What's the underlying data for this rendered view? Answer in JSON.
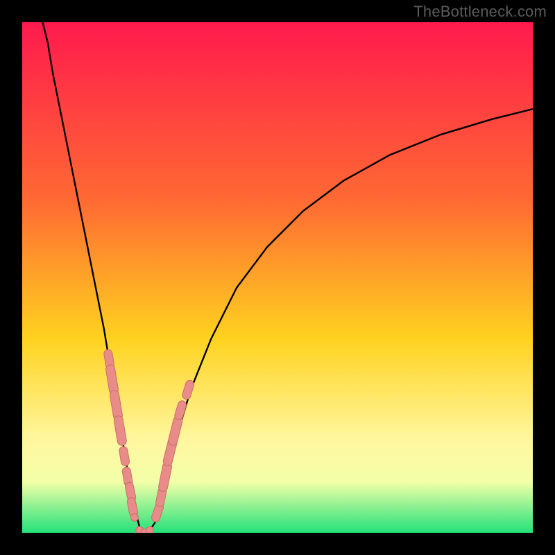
{
  "watermark": "TheBottleneck.com",
  "colors": {
    "bg_black": "#000000",
    "gradient_top": "#ff1a4d",
    "gradient_mid1": "#ff6a33",
    "gradient_mid2": "#ffd21f",
    "gradient_mid3": "#fff7a0",
    "gradient_mid4": "#f3ffa8",
    "gradient_bottom": "#23e27a",
    "curve": "#000000",
    "marker": "#e98b88",
    "marker_stroke": "#c96e68"
  },
  "chart_data": {
    "type": "line",
    "title": "",
    "xlabel": "",
    "ylabel": "",
    "xlim": [
      0,
      100
    ],
    "ylim": [
      0,
      100
    ],
    "series": [
      {
        "name": "bottleneck-curve",
        "x": [
          4,
          5,
          6,
          8,
          10,
          12,
          14,
          16,
          17,
          18,
          19,
          20,
          21,
          22,
          23,
          24,
          25,
          26,
          27,
          28,
          30,
          33,
          37,
          42,
          48,
          55,
          63,
          72,
          82,
          92,
          100
        ],
        "y": [
          100,
          96,
          90,
          80,
          70,
          60,
          50,
          40,
          34,
          28,
          22,
          16,
          10,
          5,
          1,
          0,
          0.5,
          2,
          5,
          10,
          18,
          28,
          38,
          48,
          56,
          63,
          69,
          74,
          78,
          81,
          83
        ]
      }
    ],
    "markers": [
      {
        "x": 17,
        "y": 34,
        "kind": "short"
      },
      {
        "x": 17.6,
        "y": 30,
        "kind": "long"
      },
      {
        "x": 18.4,
        "y": 25,
        "kind": "long"
      },
      {
        "x": 19.2,
        "y": 20,
        "kind": "long"
      },
      {
        "x": 20,
        "y": 15,
        "kind": "short"
      },
      {
        "x": 20.6,
        "y": 11,
        "kind": "short"
      },
      {
        "x": 21.2,
        "y": 8,
        "kind": "short"
      },
      {
        "x": 21.6,
        "y": 5,
        "kind": "short"
      },
      {
        "x": 22.0,
        "y": 3,
        "kind": "dot"
      },
      {
        "x": 23.0,
        "y": 0.5,
        "kind": "dot"
      },
      {
        "x": 24.0,
        "y": 0,
        "kind": "dot"
      },
      {
        "x": 25.0,
        "y": 0.5,
        "kind": "dot"
      },
      {
        "x": 26.5,
        "y": 4,
        "kind": "short"
      },
      {
        "x": 27.2,
        "y": 7,
        "kind": "short"
      },
      {
        "x": 28.0,
        "y": 11,
        "kind": "long"
      },
      {
        "x": 29.0,
        "y": 16,
        "kind": "long"
      },
      {
        "x": 30.0,
        "y": 20,
        "kind": "long"
      },
      {
        "x": 31.0,
        "y": 24,
        "kind": "short"
      },
      {
        "x": 32.5,
        "y": 28,
        "kind": "short"
      }
    ],
    "gradient_stops": [
      {
        "offset": 0.0,
        "key": "gradient_top"
      },
      {
        "offset": 0.35,
        "key": "gradient_mid1"
      },
      {
        "offset": 0.62,
        "key": "gradient_mid2"
      },
      {
        "offset": 0.82,
        "key": "gradient_mid3"
      },
      {
        "offset": 0.9,
        "key": "gradient_mid4"
      },
      {
        "offset": 1.0,
        "key": "gradient_bottom"
      }
    ]
  }
}
